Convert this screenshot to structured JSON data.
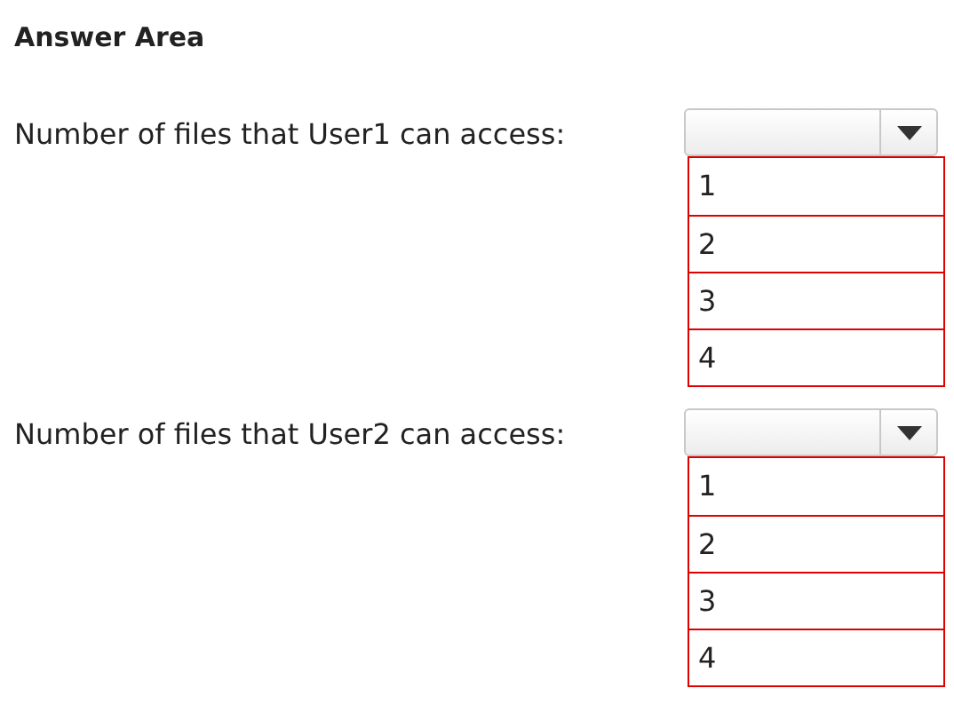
{
  "title": "Answer Area",
  "questions": [
    {
      "label": "Number of files that User1 can access:",
      "options": [
        "1",
        "2",
        "3",
        "4"
      ]
    },
    {
      "label": "Number of files that User2 can access:",
      "options": [
        "1",
        "2",
        "3",
        "4"
      ]
    }
  ]
}
